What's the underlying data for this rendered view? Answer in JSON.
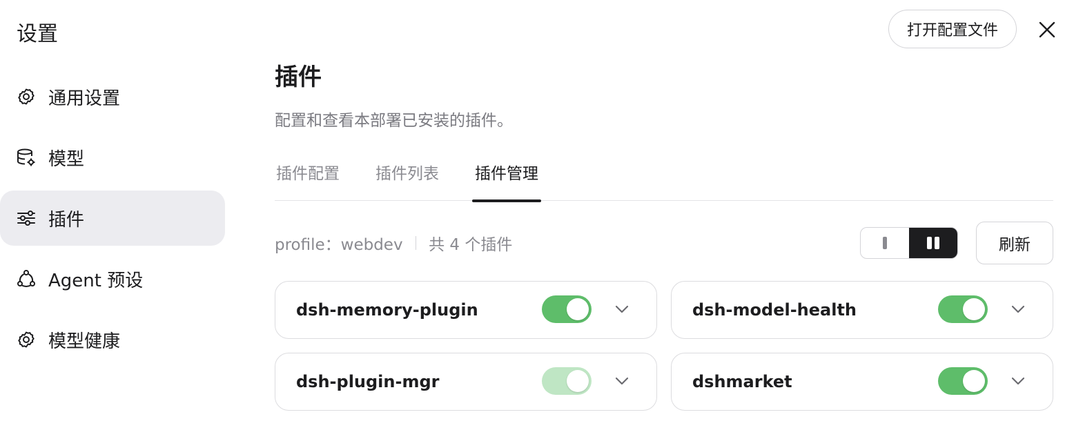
{
  "app": {
    "title": "设置"
  },
  "header": {
    "open_config_label": "打开配置文件",
    "close_icon": "close-icon"
  },
  "sidebar": {
    "items": [
      {
        "label": "通用设置",
        "icon": "gear-icon"
      },
      {
        "label": "模型",
        "icon": "database-gear-icon"
      },
      {
        "label": "插件",
        "icon": "sliders-icon",
        "active": true
      },
      {
        "label": "Agent 预设",
        "icon": "agent-network-icon"
      },
      {
        "label": "模型健康",
        "icon": "gear-icon"
      }
    ]
  },
  "main": {
    "title": "插件",
    "description": "配置和查看本部署已安装的插件。",
    "tabs": [
      {
        "label": "插件配置"
      },
      {
        "label": "插件列表"
      },
      {
        "label": "插件管理",
        "active": true
      }
    ],
    "toolbar": {
      "profile": "profile：webdev",
      "count": "共 4 个插件",
      "refresh_label": "刷新",
      "view_mode": "two-column"
    },
    "plugins": [
      {
        "name": "dsh-memory-plugin",
        "enabled": true,
        "dimmed": false
      },
      {
        "name": "dsh-model-health",
        "enabled": true,
        "dimmed": false
      },
      {
        "name": "dsh-plugin-mgr",
        "enabled": true,
        "dimmed": true
      },
      {
        "name": "dshmarket",
        "enabled": true,
        "dimmed": false
      }
    ]
  },
  "colors": {
    "accent_green": "#5ebd6a",
    "dim_green": "#bfe6c4",
    "active_bg": "#ececf0",
    "text_muted": "#8a8a90"
  }
}
